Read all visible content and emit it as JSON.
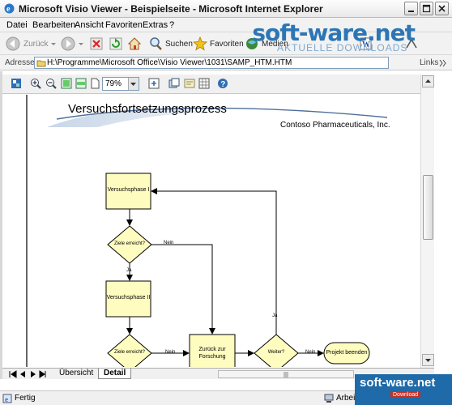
{
  "window": {
    "title": "Microsoft Visio Viewer - Beispielseite - Microsoft Internet Explorer"
  },
  "menu": [
    "Datei",
    "Bearbeiten",
    "Ansicht",
    "Favoriten",
    "Extras",
    "?"
  ],
  "toolbar": {
    "back_label": "Zurück",
    "search_label": "Suchen",
    "favorites_label": "Favoriten",
    "media_label": "Medien"
  },
  "address": {
    "label": "Adresse",
    "url": "H:\\Programme\\Microsoft Office\\Visio Viewer\\1031\\SAMP_HTM.HTM",
    "links_label": "Links"
  },
  "watermark": {
    "brand": "soft-ware.net",
    "tagline": "AKTUELLE DOWNLOADS",
    "corner_brand": "soft-ware.net",
    "corner_sub": "Download"
  },
  "viewer": {
    "zoom": "79%"
  },
  "drawing": {
    "title": "Versuchsfortsetzungsprozess",
    "company": "Contoso Pharmaceuticals, Inc.",
    "shapes": {
      "phase1": "Versuchsphase I",
      "goals1": "Ziele erreicht?",
      "phase2": "Versuchsphase II",
      "goals2": "Ziele erreicht?",
      "back": "Zurück zur Forschung",
      "further": "Weiter?",
      "end": "Projekt beenden"
    },
    "labels": {
      "nein1": "Nein",
      "ja1": "Ja",
      "nein2": "Nein",
      "ja2": "Ja",
      "nein3": "Nein"
    }
  },
  "tabs": {
    "overview": "Übersicht",
    "detail": "Detail"
  },
  "status": {
    "left": "Fertig",
    "zone": "Arbeitsplatz"
  }
}
